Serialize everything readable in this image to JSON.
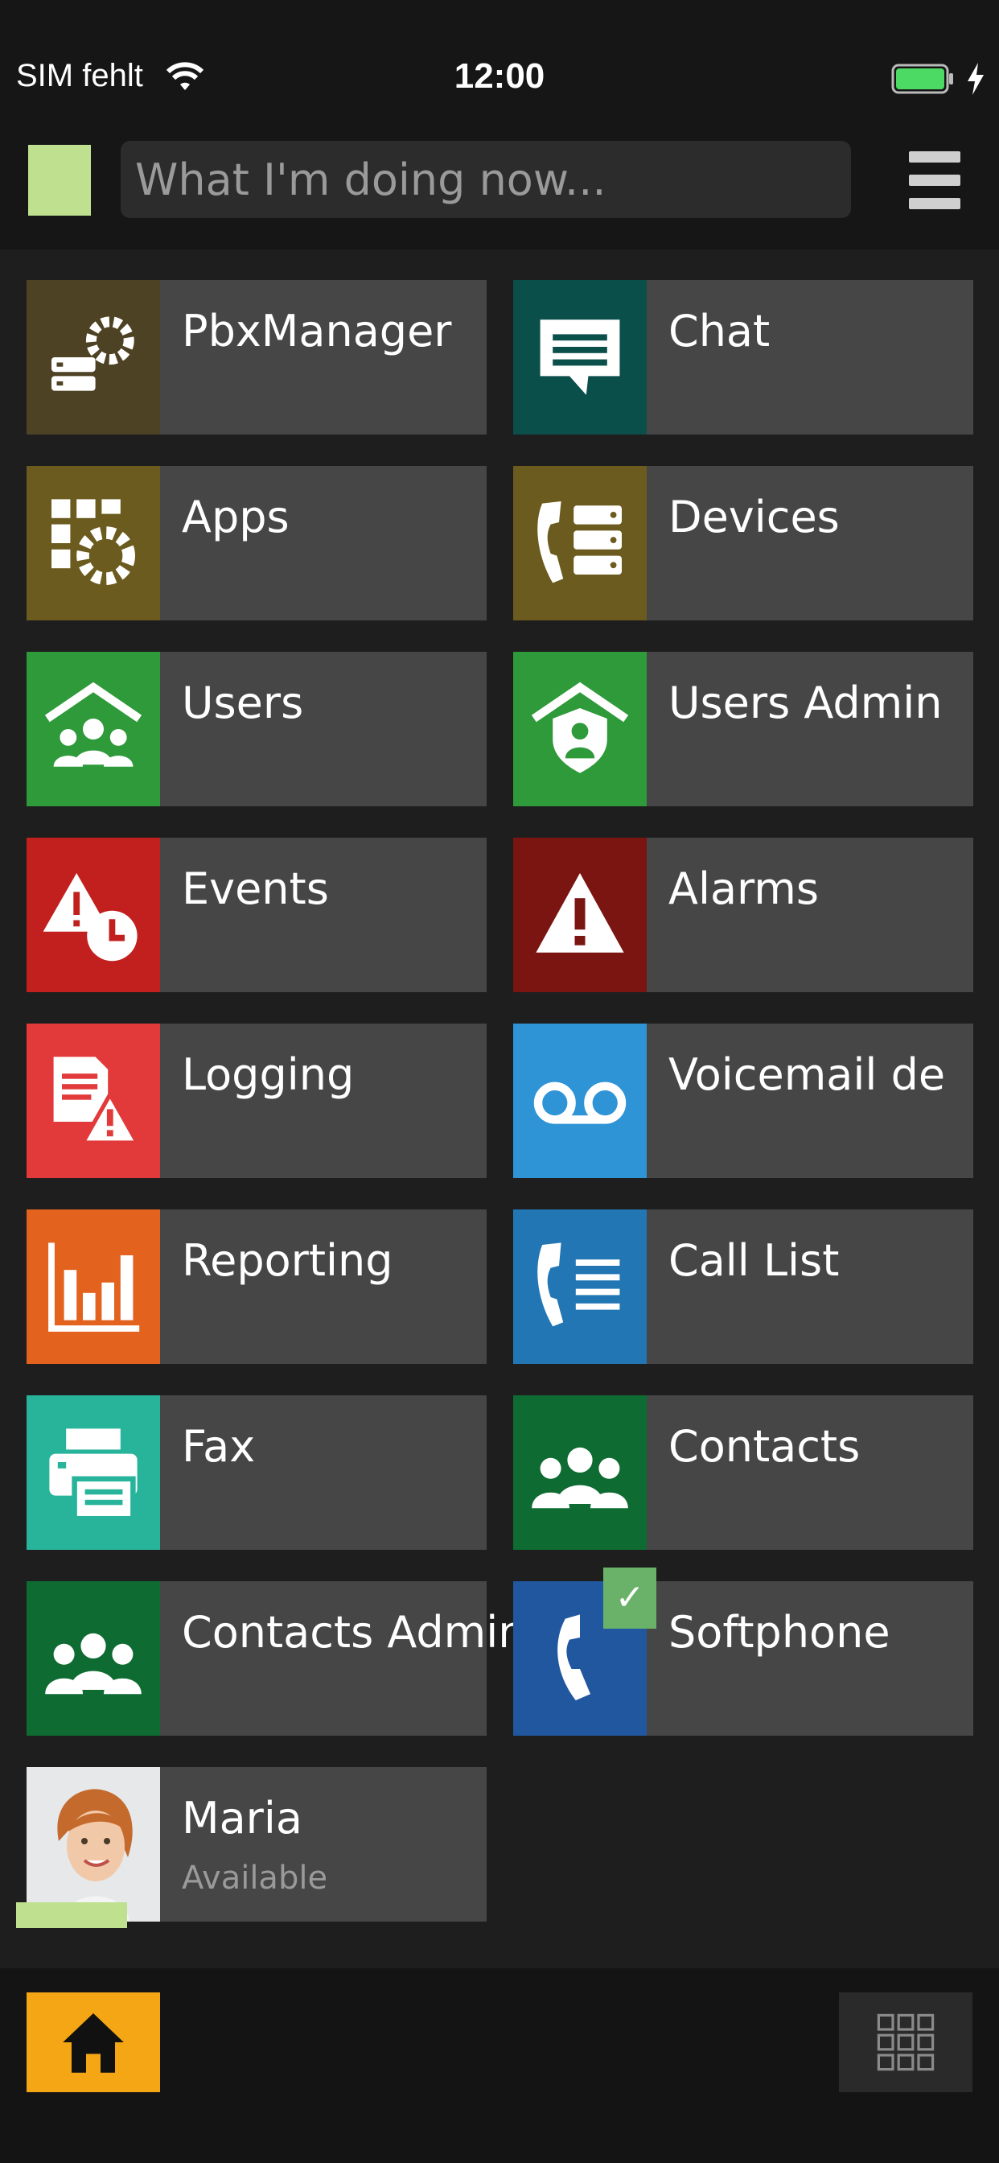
{
  "status_bar": {
    "carrier": "SIM fehlt",
    "time": "12:00",
    "wifi_icon": "wifi-icon",
    "battery_icon": "battery-charging-icon",
    "battery_color": "#4cd964"
  },
  "header": {
    "presence_color": "#bfe08f",
    "status_placeholder": "What I'm doing now...",
    "menu_icon": "hamburger-menu-icon"
  },
  "tiles": [
    {
      "label": "PbxManager",
      "icon": "pbx-manager-icon",
      "color": "#4e4224"
    },
    {
      "label": "Chat",
      "icon": "chat-icon",
      "color": "#0b4f4b"
    },
    {
      "label": "Apps",
      "icon": "apps-gear-icon",
      "color": "#6b5b1e"
    },
    {
      "label": "Devices",
      "icon": "devices-icon",
      "color": "#6b5b1e"
    },
    {
      "label": "Users",
      "icon": "users-home-icon",
      "color": "#2f9a3a"
    },
    {
      "label": "Users Admin",
      "icon": "users-admin-icon",
      "color": "#2f9a3a"
    },
    {
      "label": "Events",
      "icon": "events-icon",
      "color": "#c1201e"
    },
    {
      "label": "Alarms",
      "icon": "alarm-icon",
      "color": "#7a1512"
    },
    {
      "label": "Logging",
      "icon": "logging-icon",
      "color": "#e23a3a"
    },
    {
      "label": "Voicemail de",
      "icon": "voicemail-icon",
      "color": "#2f94d6"
    },
    {
      "label": "Reporting",
      "icon": "reporting-icon",
      "color": "#e2621e"
    },
    {
      "label": "Call List",
      "icon": "call-list-icon",
      "color": "#2276b4"
    },
    {
      "label": "Fax",
      "icon": "fax-icon",
      "color": "#27b49a"
    },
    {
      "label": "Contacts",
      "icon": "contacts-icon",
      "color": "#0e6b32"
    },
    {
      "label": "Contacts Admin",
      "icon": "contacts-admin-icon",
      "color": "#0e6b32"
    },
    {
      "label": "Softphone",
      "icon": "softphone-icon",
      "color": "#21579e",
      "checked": true
    },
    {
      "label": "Maria",
      "sublabel": "Available",
      "icon": "avatar",
      "presence_color": "#bfe08f"
    }
  ],
  "softphone_check": "✓",
  "bottom_bar": {
    "home_icon": "home-icon",
    "home_color": "#f4a614",
    "apps_grid_icon": "apps-grid-icon"
  }
}
